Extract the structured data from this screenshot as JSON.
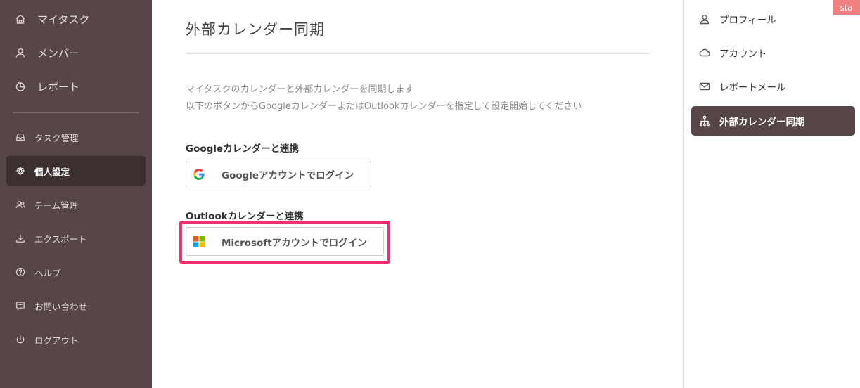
{
  "sidebar": {
    "items": [
      {
        "label": "マイタスク",
        "icon": "home-icon"
      },
      {
        "label": "メンバー",
        "icon": "user-icon"
      },
      {
        "label": "レポート",
        "icon": "report-icon"
      },
      {
        "label": "タスク管理",
        "icon": "inbox-icon"
      },
      {
        "label": "個人設定",
        "icon": "gear-icon",
        "active": true
      },
      {
        "label": "チーム管理",
        "icon": "team-icon"
      },
      {
        "label": "エクスポート",
        "icon": "download-icon"
      },
      {
        "label": "ヘルプ",
        "icon": "help-icon"
      },
      {
        "label": "お問い合わせ",
        "icon": "message-icon"
      },
      {
        "label": "ログアウト",
        "icon": "power-icon"
      }
    ]
  },
  "main": {
    "title": "外部カレンダー同期",
    "description": [
      "マイタスクのカレンダーと外部カレンダーを同期します",
      "以下のボタンからGoogleカレンダーまたはOutlookカレンダーを指定して設定開始してください"
    ],
    "google": {
      "heading": "Googleカレンダーと連携",
      "button_label": "Googleアカウントでログイン",
      "icon": "google-logo"
    },
    "outlook": {
      "heading": "Outlookカレンダーと連携",
      "button_label": "Microsoftアカウントでログイン",
      "icon": "microsoft-logo"
    }
  },
  "right_panel": {
    "badge": "sta",
    "items": [
      {
        "label": "プロフィール",
        "icon": "user-icon"
      },
      {
        "label": "アカウント",
        "icon": "cloud-icon"
      },
      {
        "label": "レポートメール",
        "icon": "mail-icon"
      },
      {
        "label": "外部カレンダー同期",
        "icon": "sitemap-icon",
        "active": true
      }
    ]
  },
  "colors": {
    "sidebar_bg": "#574647",
    "sidebar_active_bg": "#3c2f30",
    "highlight": "#f2306e",
    "badge_bg": "#f07f80"
  }
}
